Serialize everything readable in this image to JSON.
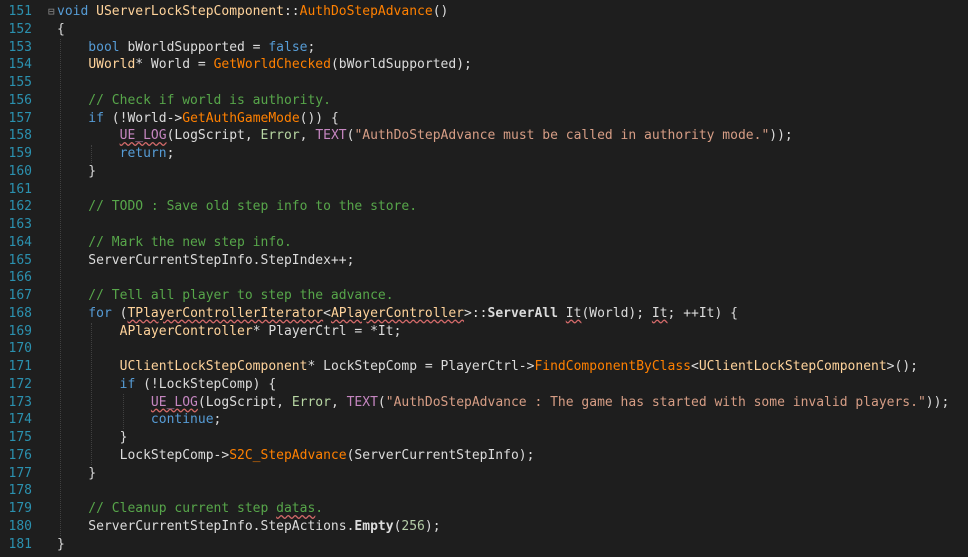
{
  "editor": {
    "background": "#1e1e1e",
    "line_number_color": "#2b91af",
    "lines": [
      {
        "n": "151",
        "fold": "⊟",
        "tokens": [
          {
            "t": "void ",
            "c": "kw"
          },
          {
            "t": "UServerLockStepComponent",
            "c": "struct"
          },
          {
            "t": "::",
            "c": "plain"
          },
          {
            "t": "AuthDoStepAdvance",
            "c": "fn"
          },
          {
            "t": "()",
            "c": "plain"
          }
        ]
      },
      {
        "n": "152",
        "fold": "",
        "tokens": [
          {
            "t": "{",
            "c": "plain"
          }
        ]
      },
      {
        "n": "153",
        "fold": "",
        "tokens": [
          {
            "t": "    bool ",
            "c": "kw"
          },
          {
            "t": "bWorldSupported",
            "c": "plain"
          },
          {
            "t": " = ",
            "c": "plain"
          },
          {
            "t": "false",
            "c": "kw"
          },
          {
            "t": ";",
            "c": "plain"
          }
        ]
      },
      {
        "n": "154",
        "fold": "",
        "tokens": [
          {
            "t": "    ",
            "c": "plain"
          },
          {
            "t": "UWorld",
            "c": "struct"
          },
          {
            "t": "* World = ",
            "c": "plain"
          },
          {
            "t": "GetWorldChecked",
            "c": "fn"
          },
          {
            "t": "(bWorldSupported);",
            "c": "plain"
          }
        ]
      },
      {
        "n": "155",
        "fold": "",
        "tokens": []
      },
      {
        "n": "156",
        "fold": "",
        "tokens": [
          {
            "t": "    // Check if world is authority.",
            "c": "comment"
          }
        ]
      },
      {
        "n": "157",
        "fold": "",
        "tokens": [
          {
            "t": "    if ",
            "c": "kw"
          },
          {
            "t": "(!World->",
            "c": "plain"
          },
          {
            "t": "GetAuthGameMode",
            "c": "fn"
          },
          {
            "t": "()) {",
            "c": "plain"
          }
        ]
      },
      {
        "n": "158",
        "fold": "",
        "tokens": [
          {
            "t": "        ",
            "c": "plain"
          },
          {
            "t": "UE_LOG",
            "c": "macro",
            "sq": true
          },
          {
            "t": "(LogScript, ",
            "c": "plain"
          },
          {
            "t": "Error",
            "c": "enum"
          },
          {
            "t": ", ",
            "c": "plain"
          },
          {
            "t": "TEXT",
            "c": "macro"
          },
          {
            "t": "(",
            "c": "plain"
          },
          {
            "t": "\"AuthDoStepAdvance must be called in authority mode.\"",
            "c": "str"
          },
          {
            "t": "));",
            "c": "plain"
          }
        ]
      },
      {
        "n": "159",
        "fold": "",
        "tokens": [
          {
            "t": "        return",
            "c": "kw"
          },
          {
            "t": ";",
            "c": "plain"
          }
        ]
      },
      {
        "n": "160",
        "fold": "",
        "tokens": [
          {
            "t": "    }",
            "c": "plain"
          }
        ]
      },
      {
        "n": "161",
        "fold": "",
        "tokens": []
      },
      {
        "n": "162",
        "fold": "",
        "tokens": [
          {
            "t": "    // TODO : Save old step info to the store.",
            "c": "comment"
          }
        ]
      },
      {
        "n": "163",
        "fold": "",
        "tokens": []
      },
      {
        "n": "164",
        "fold": "",
        "tokens": [
          {
            "t": "    // Mark the new step info.",
            "c": "comment"
          }
        ]
      },
      {
        "n": "165",
        "fold": "",
        "tokens": [
          {
            "t": "    ServerCurrentStepInfo.StepIndex++;",
            "c": "plain"
          }
        ]
      },
      {
        "n": "166",
        "fold": "",
        "tokens": []
      },
      {
        "n": "167",
        "fold": "",
        "tokens": [
          {
            "t": "    // Tell all player to step the advance.",
            "c": "comment"
          }
        ]
      },
      {
        "n": "168",
        "fold": "",
        "tokens": [
          {
            "t": "    for ",
            "c": "kw"
          },
          {
            "t": "(",
            "c": "plain"
          },
          {
            "t": "TPlayerControllerIterator",
            "c": "struct",
            "sq": true
          },
          {
            "t": "<",
            "c": "plain"
          },
          {
            "t": "APlayerController",
            "c": "struct",
            "sq": true
          },
          {
            "t": ">::",
            "c": "plain"
          },
          {
            "t": "ServerAll",
            "c": "plain",
            "b": true
          },
          {
            "t": " ",
            "c": "plain"
          },
          {
            "t": "It",
            "c": "plain",
            "sq": true
          },
          {
            "t": "(World); ",
            "c": "plain"
          },
          {
            "t": "It",
            "c": "plain",
            "sq": true
          },
          {
            "t": "; ++It) {",
            "c": "plain"
          }
        ]
      },
      {
        "n": "169",
        "fold": "",
        "tokens": [
          {
            "t": "        ",
            "c": "plain"
          },
          {
            "t": "APlayerController",
            "c": "struct"
          },
          {
            "t": "* PlayerCtrl = *It;",
            "c": "plain"
          }
        ]
      },
      {
        "n": "170",
        "fold": "",
        "tokens": []
      },
      {
        "n": "171",
        "fold": "",
        "tokens": [
          {
            "t": "        ",
            "c": "plain"
          },
          {
            "t": "UClientLockStepComponent",
            "c": "struct"
          },
          {
            "t": "* LockStepComp = PlayerCtrl->",
            "c": "plain"
          },
          {
            "t": "FindComponentByClass",
            "c": "fn"
          },
          {
            "t": "<",
            "c": "plain"
          },
          {
            "t": "UClientLockStepComponent",
            "c": "struct"
          },
          {
            "t": ">();",
            "c": "plain"
          }
        ]
      },
      {
        "n": "172",
        "fold": "",
        "tokens": [
          {
            "t": "        if ",
            "c": "kw"
          },
          {
            "t": "(!LockStepComp) {",
            "c": "plain"
          }
        ]
      },
      {
        "n": "173",
        "fold": "",
        "tokens": [
          {
            "t": "            ",
            "c": "plain"
          },
          {
            "t": "UE_LOG",
            "c": "macro",
            "sq": true
          },
          {
            "t": "(LogScript, ",
            "c": "plain"
          },
          {
            "t": "Error",
            "c": "enum"
          },
          {
            "t": ", ",
            "c": "plain"
          },
          {
            "t": "TEXT",
            "c": "macro"
          },
          {
            "t": "(",
            "c": "plain"
          },
          {
            "t": "\"AuthDoStepAdvance : The game has started with some invalid players.\"",
            "c": "str"
          },
          {
            "t": "));",
            "c": "plain"
          }
        ]
      },
      {
        "n": "174",
        "fold": "",
        "tokens": [
          {
            "t": "            continue",
            "c": "kw"
          },
          {
            "t": ";",
            "c": "plain"
          }
        ]
      },
      {
        "n": "175",
        "fold": "",
        "tokens": [
          {
            "t": "        }",
            "c": "plain"
          }
        ]
      },
      {
        "n": "176",
        "fold": "",
        "tokens": [
          {
            "t": "        LockStepComp->",
            "c": "plain"
          },
          {
            "t": "S2C_StepAdvance",
            "c": "fn"
          },
          {
            "t": "(ServerCurrentStepInfo);",
            "c": "plain"
          }
        ]
      },
      {
        "n": "177",
        "fold": "",
        "tokens": [
          {
            "t": "    }",
            "c": "plain"
          }
        ]
      },
      {
        "n": "178",
        "fold": "",
        "tokens": []
      },
      {
        "n": "179",
        "fold": "",
        "tokens": [
          {
            "t": "    // Cleanup current step ",
            "c": "comment"
          },
          {
            "t": "datas",
            "c": "comment",
            "sq": true
          },
          {
            "t": ".",
            "c": "comment"
          }
        ]
      },
      {
        "n": "180",
        "fold": "",
        "tokens": [
          {
            "t": "    ServerCurrentStepInfo.StepActions.",
            "c": "plain"
          },
          {
            "t": "Empty",
            "c": "plain",
            "b": true
          },
          {
            "t": "(",
            "c": "plain"
          },
          {
            "t": "256",
            "c": "num"
          },
          {
            "t": ");",
            "c": "plain"
          }
        ]
      },
      {
        "n": "181",
        "fold": "",
        "tokens": [
          {
            "t": "}",
            "c": "plain"
          }
        ]
      }
    ]
  }
}
